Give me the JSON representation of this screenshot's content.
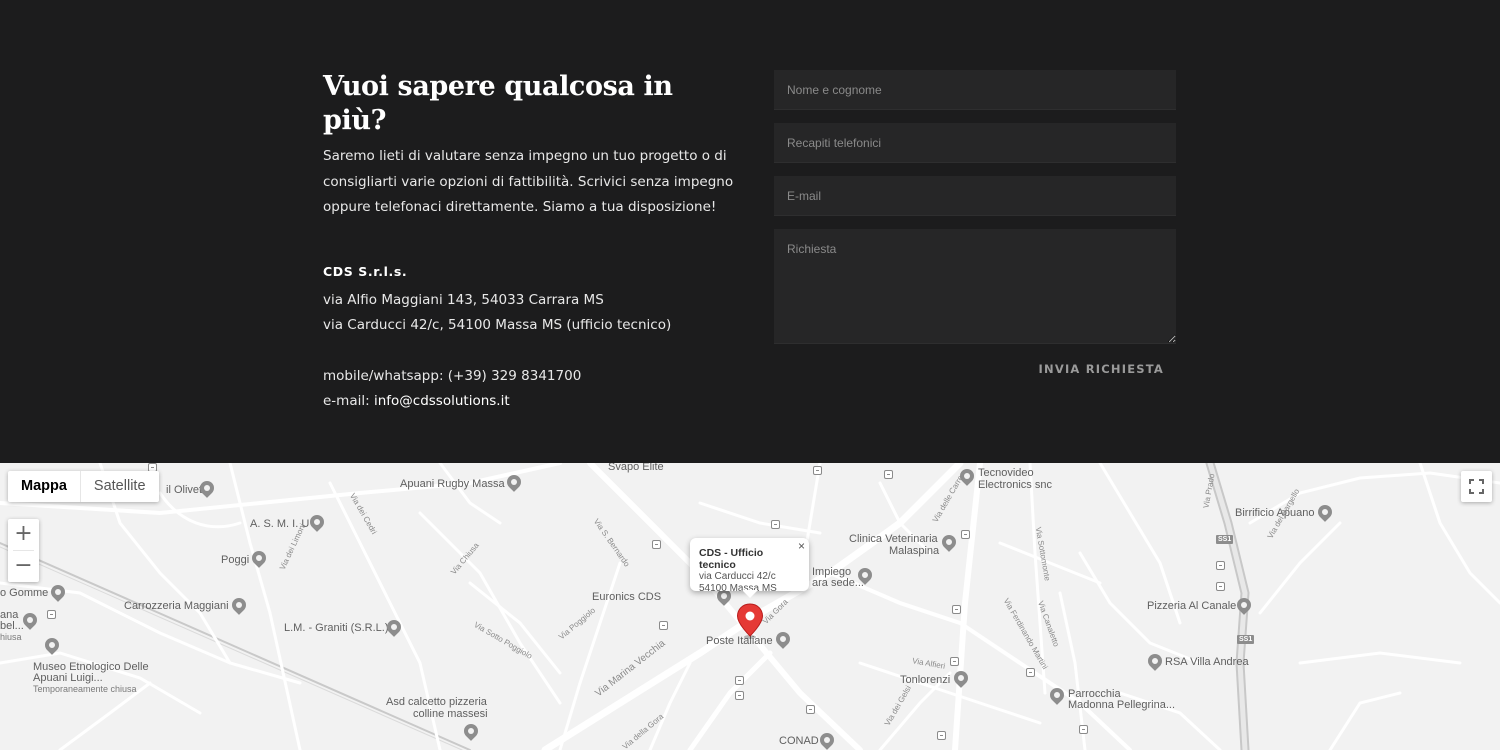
{
  "contact": {
    "heading": "Vuoi sapere qualcosa in più?",
    "intro": "Saremo lieti di valutare senza impegno un tuo progetto o di consigliarti varie opzioni di fattibilità. Scrivici senza impegno oppure telefonaci direttamente. Siamo a tua disposizione!",
    "company": "CDS S.r.l.s.",
    "address_1": "via Alfio Maggiani 143, 54033 Carrara MS",
    "address_2": "via Carducci 42/c, 54100 Massa MS (ufficio tecnico)",
    "phone": "mobile/whatsapp: (+39) 329 8341700",
    "email_prefix": "e-mail: ",
    "email": "info@cdssolutions.it"
  },
  "form": {
    "name_placeholder": "Nome e cognome",
    "phone_placeholder": "Recapiti telefonici",
    "email_placeholder": "E-mail",
    "request_placeholder": "Richiesta",
    "submit_label": "INVIA RICHIESTA"
  },
  "map": {
    "type_map": "Mappa",
    "type_satellite": "Satellite",
    "zoom_in": "+",
    "zoom_out": "−",
    "info": {
      "title": "CDS - Ufficio tecnico",
      "line1": "via Carducci 42/c",
      "line2": "54100 Massa MS",
      "close": "×"
    },
    "places": {
      "oliveti": "il Oliveti",
      "rugby": "Apuani Rugby Massa",
      "svapo": "Svapo Elite",
      "tecnovideo_1": "Tecnovideo",
      "tecnovideo_2": "Electronics snc",
      "birrificio": "Birrificio Apuano",
      "asmiu": "A. S. M. I. U",
      "poggi": "Poggi",
      "gomme": "o Gomme",
      "carrozzeria": "Carrozzeria Maggiani",
      "lm": "L.M. - Graniti (S.R.L.)",
      "museo_1": "Museo Etnologico Delle",
      "museo_2": "Apuani Luigi...",
      "museo_3": "Temporaneamente chiusa",
      "ana": "ana",
      "bel": "bel...",
      "hiusa": "hiusa",
      "asd_1": "Asd calcetto pizzeria",
      "asd_2": "colline massesi",
      "euronics": "Euronics CDS",
      "poste": "Poste Italiane",
      "clinica_1": "Clinica Veterinaria",
      "clinica_2": "Malaspina",
      "impiego_1": "Impiego",
      "impiego_2": "ara sede...",
      "pizzeria": "Pizzeria Al Canale",
      "rsa": "RSA Villa Andrea",
      "tonlorenzi": "Tonlorenzi",
      "parrocchia_1": "Parrocchia",
      "parrocchia_2": "Madonna Pellegrina...",
      "conad": "CONAD"
    },
    "streets": {
      "cedri": "Via dei Cedri",
      "limoni": "Via dei Limoni",
      "chiusa": "Via Chiusa",
      "bernardo": "Via S. Bernardo",
      "poggiolo": "Via Poggiolo",
      "sotto_poggiolo": "Via Sotto Poggiolo",
      "marina": "Via Marina Vecchia",
      "gora": "Via della Gora",
      "gora2": "Via Gora",
      "sottomonte": "Via Sottomonte",
      "ferdinando": "Via Ferdinando Martini",
      "canaletto": "Via Canaletto",
      "alfieri": "Via Alfieri",
      "gelsi": "Via dei Gelsi",
      "prado": "Via Prado",
      "bargello": "Via del Bargello",
      "carre": "Via delle Carre",
      "ss1": "SS1"
    },
    "colors": {
      "pin": "#e53935",
      "roads": "#ffffff",
      "background": "#f2f2f2"
    }
  },
  "icons": [
    "close-icon",
    "fullscreen-icon",
    "location-pin-icon",
    "plus-icon",
    "minus-icon"
  ]
}
